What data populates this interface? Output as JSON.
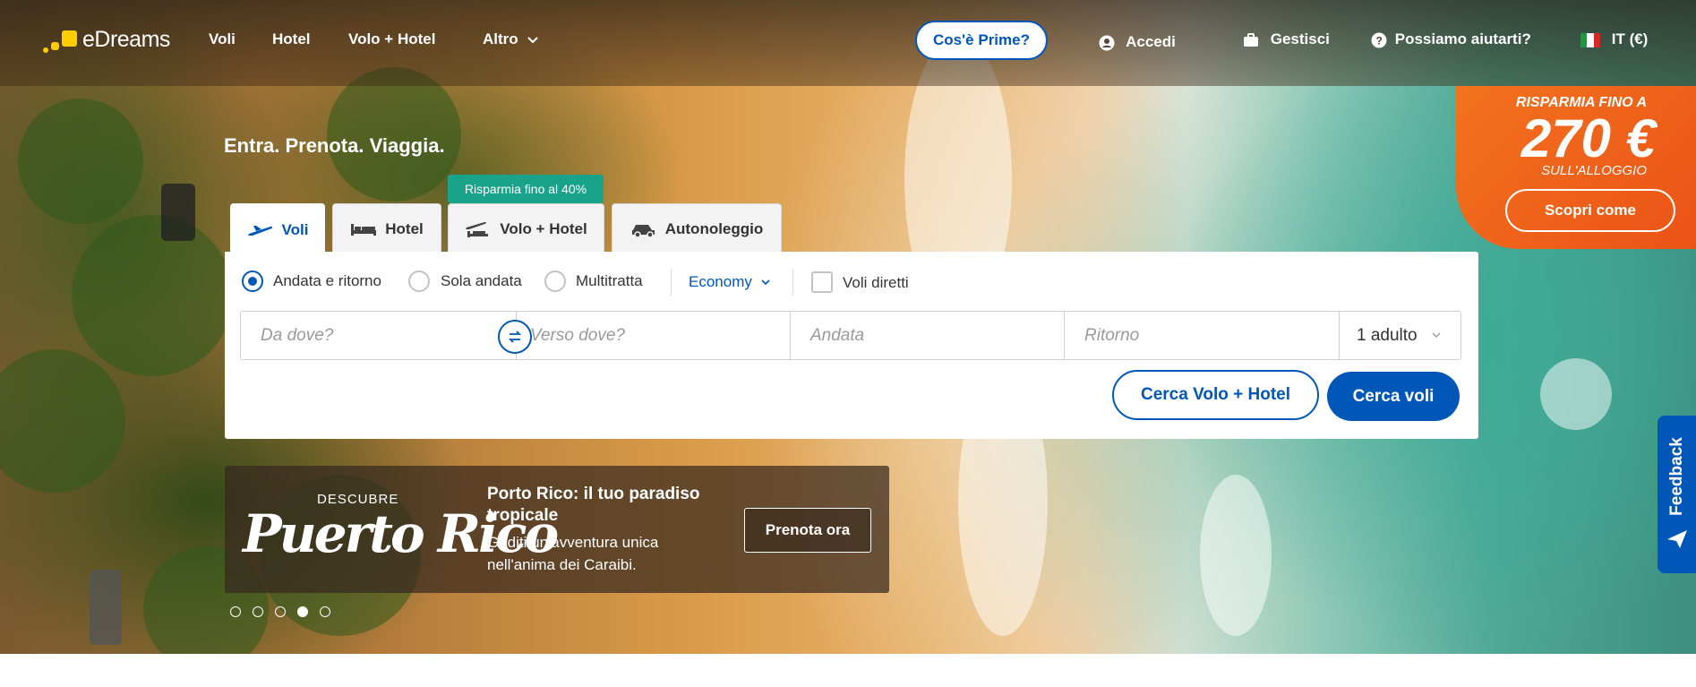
{
  "header": {
    "logo_text": "eDreams",
    "nav": [
      "Voli",
      "Hotel",
      "Volo + Hotel",
      "Altro"
    ],
    "prime_button": "Cos'è Prime?",
    "login": "Accedi",
    "manage": "Gestisci",
    "help": "Possiamo aiutarti?",
    "language": "IT (€)"
  },
  "promo": {
    "line1": "RISPARMIA FINO A",
    "amount": "270 €",
    "line3": "SULL'ALLOGGIO",
    "button": "Scopri come"
  },
  "tagline": "Entra. Prenota. Viaggia.",
  "tabs": [
    "Voli",
    "Hotel",
    "Volo + Hotel",
    "Autonoleggio"
  ],
  "badge": "Risparmia fino al 40%",
  "search": {
    "trip_types": [
      "Andata e ritorno",
      "Sola andata",
      "Multitratta"
    ],
    "selected_trip_type": "Andata e ritorno",
    "cabin": "Economy",
    "direct_label": "Voli diretti",
    "from_placeholder": "Da dove?",
    "to_placeholder": "Verso dove?",
    "depart_placeholder": "Andata",
    "return_placeholder": "Ritorno",
    "passengers": "1 adulto",
    "btn_package": "Cerca Volo + Hotel",
    "btn_flights": "Cerca voli"
  },
  "banner": {
    "pre": "DESCUBRE",
    "script": "Puerto Rico",
    "title": "Porto Rico: il tuo paradiso tropicale",
    "description": "Goditi un'avventura unica nell'anima dei Caraibi.",
    "cta": "Prenota ora",
    "slides": 5,
    "active_slide": 4
  },
  "feedback": "Feedback",
  "colors": {
    "brand_blue": "#0057b8",
    "promo_orange": "#f06420",
    "badge_green": "#1aa38b",
    "logo_yellow": "#ffcc00"
  }
}
